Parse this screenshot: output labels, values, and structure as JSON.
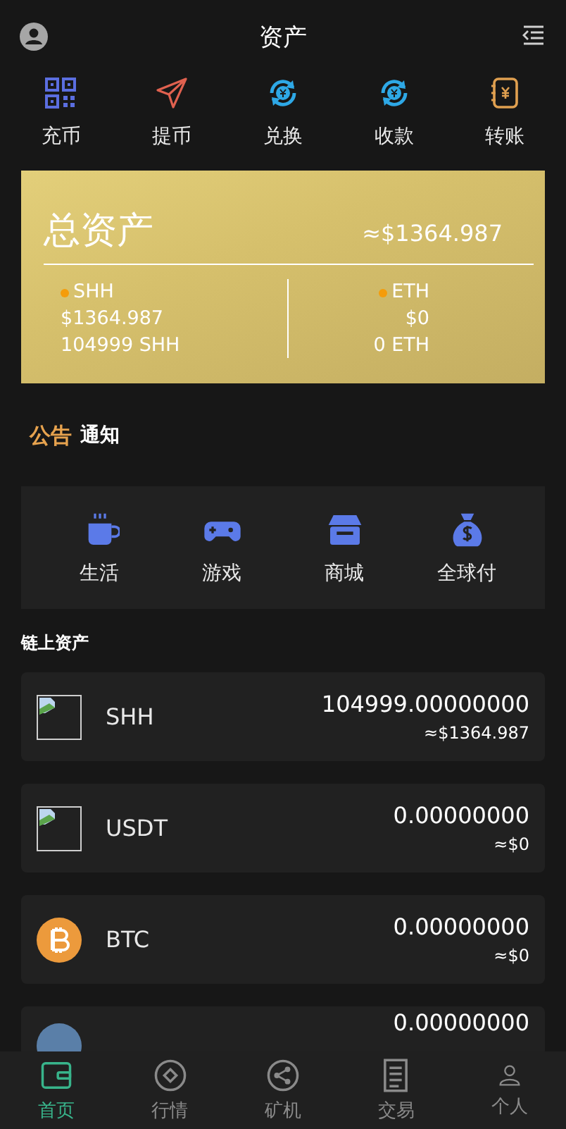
{
  "header": {
    "title": "资产"
  },
  "actions": [
    {
      "label": "充币",
      "kind": "qr"
    },
    {
      "label": "提币",
      "kind": "send"
    },
    {
      "label": "兑换",
      "kind": "exchange"
    },
    {
      "label": "收款",
      "kind": "exchange"
    },
    {
      "label": "转账",
      "kind": "ledger"
    }
  ],
  "total": {
    "title": "总资产",
    "value": "≈$1364.987",
    "coins": [
      {
        "name": "SHH",
        "usd": "$1364.987",
        "amount": "104999 SHH",
        "color": "#f59c0a"
      },
      {
        "name": "ETH",
        "usd": "$0",
        "amount": "0 ETH",
        "color": "#f59c0a"
      }
    ]
  },
  "notice": {
    "badge": "公告",
    "title": "通知"
  },
  "services": [
    {
      "label": "生活",
      "kind": "cup"
    },
    {
      "label": "游戏",
      "kind": "gamepad"
    },
    {
      "label": "商城",
      "kind": "shop"
    },
    {
      "label": "全球付",
      "kind": "moneybag"
    }
  ],
  "chain_assets": {
    "title": "链上资产",
    "items": [
      {
        "kind": "broken",
        "name": "SHH",
        "amount": "104999.00000000",
        "usd": "≈$1364.987"
      },
      {
        "kind": "broken",
        "name": "USDT",
        "amount": "0.00000000",
        "usd": "≈$0"
      },
      {
        "kind": "btc",
        "name": "BTC",
        "amount": "0.00000000",
        "usd": "≈$0"
      },
      {
        "kind": "coin",
        "amount": "0.00000000"
      }
    ]
  },
  "nav": [
    {
      "label": "首页",
      "kind": "wallet",
      "selected": true
    },
    {
      "label": "行情",
      "kind": "market",
      "selected": false
    },
    {
      "label": "矿机",
      "kind": "share",
      "selected": false
    },
    {
      "label": "交易",
      "kind": "doc",
      "selected": false
    },
    {
      "label": "个人",
      "kind": "person",
      "selected": false
    }
  ]
}
